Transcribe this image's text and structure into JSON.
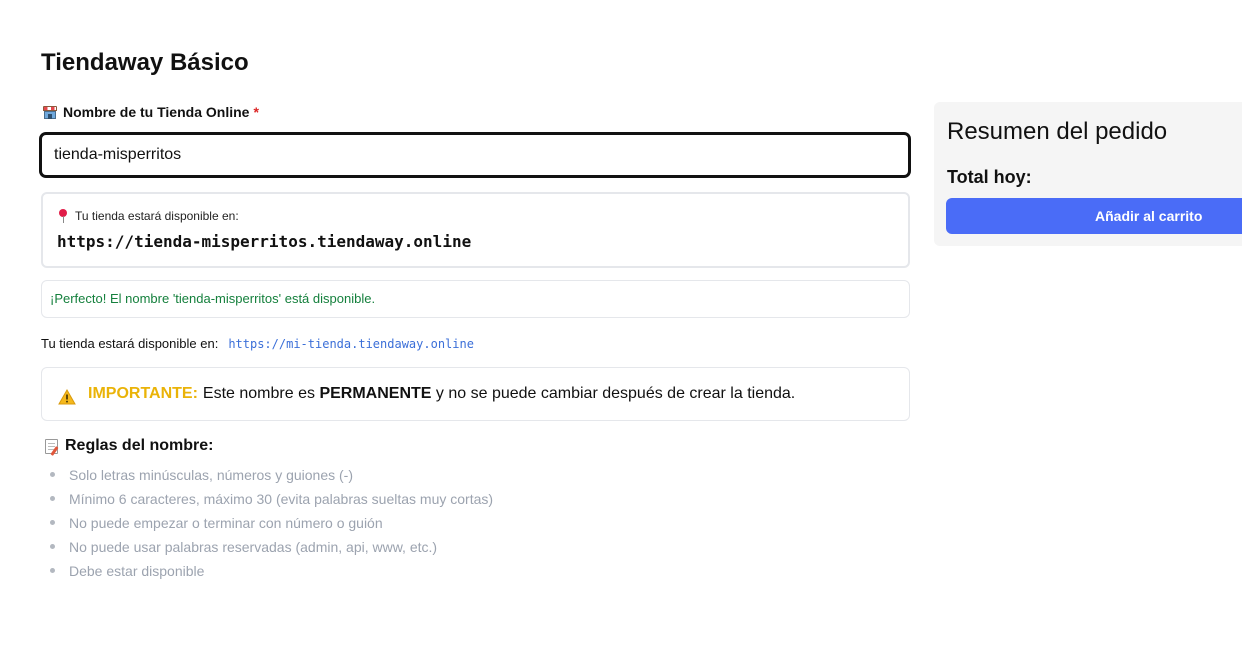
{
  "page": {
    "title": "Tiendaway Básico"
  },
  "store_name": {
    "label": "Nombre de tu Tienda Online",
    "required_mark": "*",
    "value": "tienda-misperritos"
  },
  "preview": {
    "label": "Tu tienda estará disponible en:",
    "url": "https://tienda-misperritos.tiendaway.online"
  },
  "status": {
    "message": "¡Perfecto! El nombre 'tienda-misperritos' está disponible.",
    "color": "#15803d"
  },
  "availability": {
    "label": "Tu tienda estará disponible en:",
    "url": "https://mi-tienda.tiendaway.online"
  },
  "warning": {
    "prefix": "IMPORTANTE:",
    "text_1": "Este nombre es",
    "emphasis": "PERMANENTE",
    "text_2": "y no se puede cambiar después de crear la tienda."
  },
  "rules": {
    "title": "Reglas del nombre:",
    "items": [
      "Solo letras minúsculas, números y guiones (-)",
      "Mínimo 6 caracteres, máximo 30 (evita palabras sueltas muy cortas)",
      "No puede empezar o terminar con número o guión",
      "No puede usar palabras reservadas (admin, api, www, etc.)",
      "Debe estar disponible"
    ]
  },
  "summary": {
    "title": "Resumen del pedido",
    "total_label": "Total hoy:",
    "add_to_cart": "Añadir al carrito",
    "accent": "#4a6cf7"
  },
  "icons": {
    "store": "store-icon",
    "pin": "pin-icon",
    "warning": "warning-icon",
    "memo": "memo-icon"
  }
}
